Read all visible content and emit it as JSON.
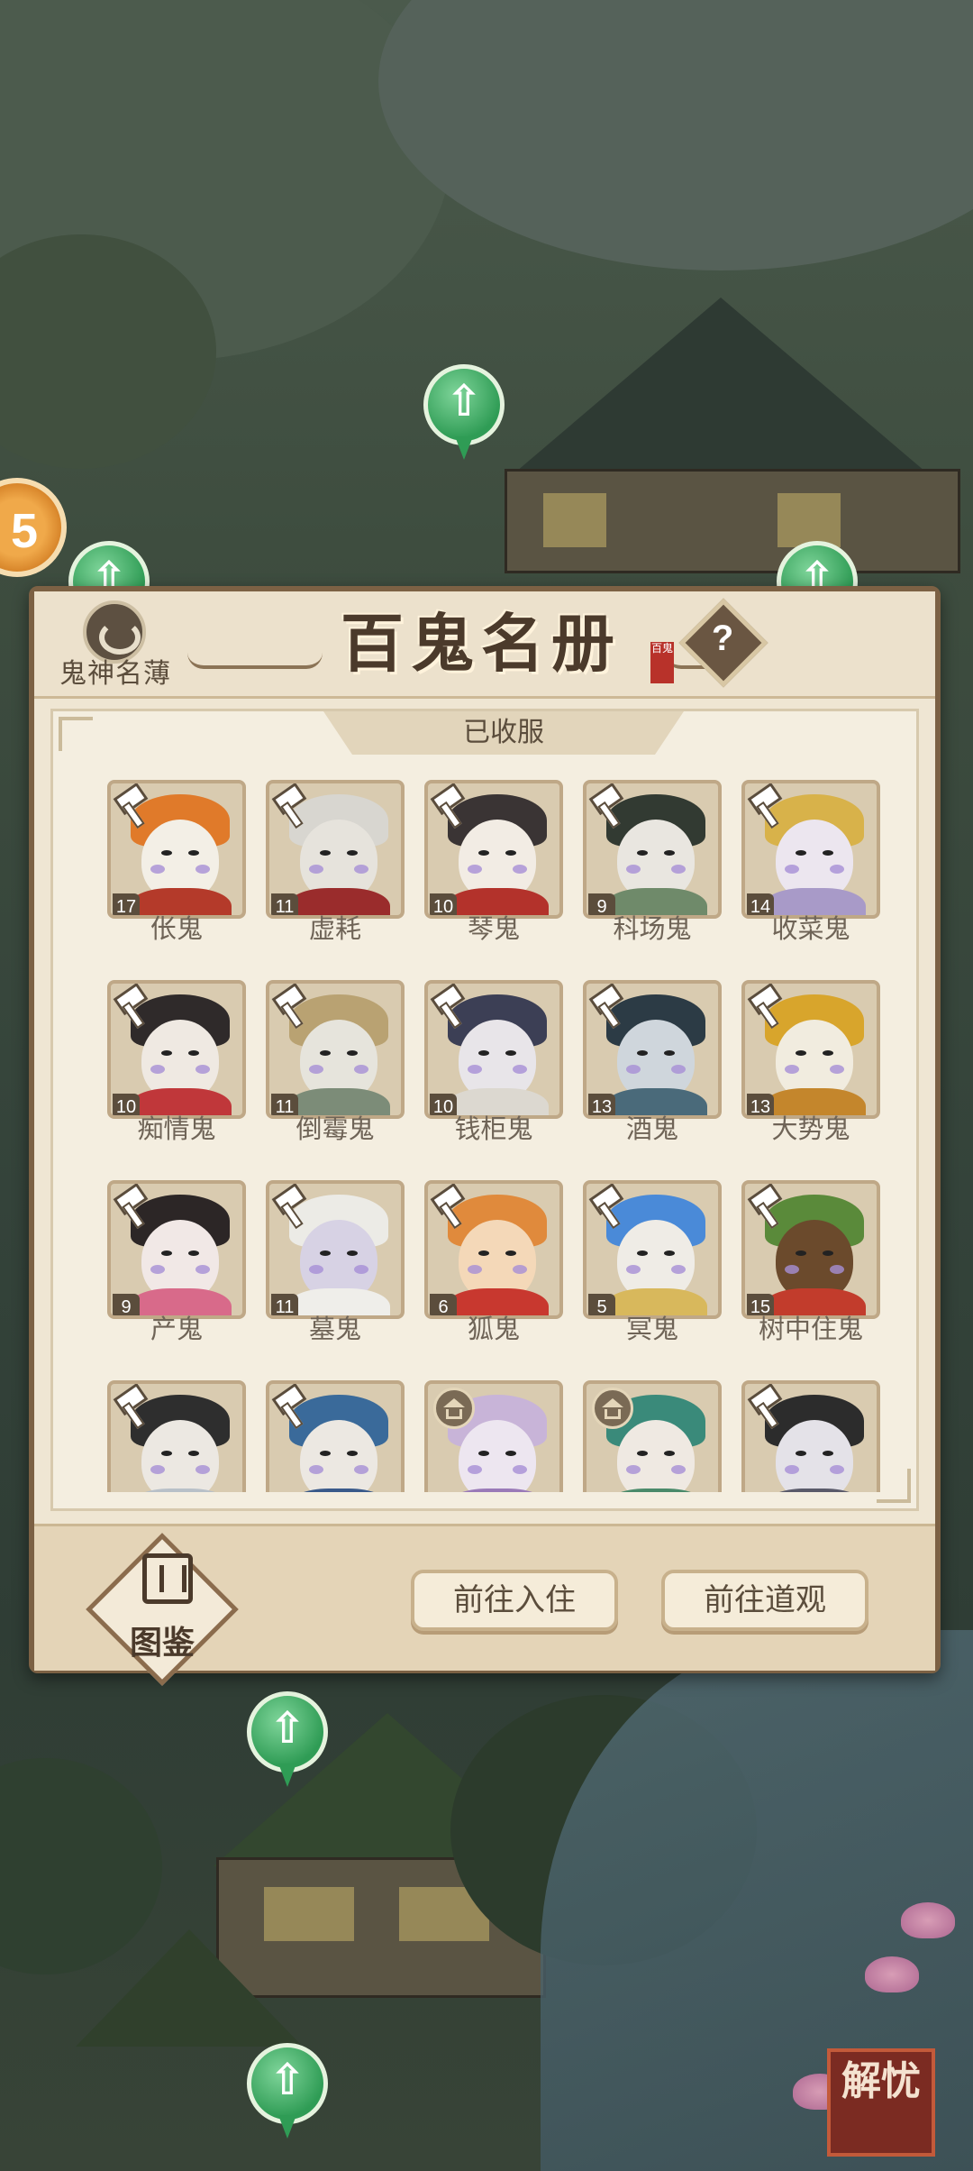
{
  "panel": {
    "codex_label": "鬼神名薄",
    "title": "百鬼名册",
    "stamp": "百鬼",
    "help_icon": "?",
    "tab": "已收服"
  },
  "ghosts": [
    {
      "name": "伥鬼",
      "level": "17",
      "marker": "hammer",
      "hair": "#e07a2a",
      "skin": "#f3efe6",
      "body": "#b43a2a"
    },
    {
      "name": "虚耗",
      "level": "11",
      "marker": "hammer",
      "hair": "#d8d6d0",
      "skin": "#e6e3dc",
      "body": "#9a2c2c"
    },
    {
      "name": "琴鬼",
      "level": "10",
      "marker": "hammer",
      "hair": "#3a3434",
      "skin": "#f2ece4",
      "body": "#b3322b"
    },
    {
      "name": "科场鬼",
      "level": "9",
      "marker": "hammer",
      "hair": "#323a32",
      "skin": "#e9e6e0",
      "body": "#6f8a6a"
    },
    {
      "name": "收菜鬼",
      "level": "14",
      "marker": "hammer",
      "hair": "#d8b24a",
      "skin": "#ece6ef",
      "body": "#a89ac8"
    },
    {
      "name": "痴情鬼",
      "level": "10",
      "marker": "hammer",
      "hair": "#2f2a2a",
      "skin": "#efe9e2",
      "body": "#c0373a"
    },
    {
      "name": "倒霉鬼",
      "level": "11",
      "marker": "hammer",
      "hair": "#b9a272",
      "skin": "#e6e4dc",
      "body": "#7c8c78"
    },
    {
      "name": "钱柜鬼",
      "level": "10",
      "marker": "hammer",
      "hair": "#3c3f55",
      "skin": "#e8e5e9",
      "body": "#dcd8d0"
    },
    {
      "name": "酒鬼",
      "level": "13",
      "marker": "hammer",
      "hair": "#2c3b45",
      "skin": "#cfd6dc",
      "body": "#4a6a7a"
    },
    {
      "name": "大势鬼",
      "level": "13",
      "marker": "hammer",
      "hair": "#d8a52c",
      "skin": "#f1ecdf",
      "body": "#c4862c"
    },
    {
      "name": "产鬼",
      "level": "9",
      "marker": "hammer",
      "hair": "#2c2626",
      "skin": "#f1e8e6",
      "body": "#d86a8a"
    },
    {
      "name": "墓鬼",
      "level": "11",
      "marker": "hammer",
      "hair": "#ecebe6",
      "skin": "#d7d2e4",
      "body": "#efeeea"
    },
    {
      "name": "狐鬼",
      "level": "6",
      "marker": "hammer",
      "hair": "#e08a3c",
      "skin": "#f4d8b8",
      "body": "#c8382f"
    },
    {
      "name": "冥鬼",
      "level": "5",
      "marker": "hammer",
      "hair": "#4a8ad8",
      "skin": "#efece6",
      "body": "#d8b85c"
    },
    {
      "name": "树中住鬼",
      "level": "15",
      "marker": "hammer",
      "hair": "#5a8a3a",
      "skin": "#6b4a2c",
      "body": "#c23c2c"
    },
    {
      "name": "",
      "level": "",
      "marker": "hammer",
      "hair": "#2e2e2e",
      "skin": "#ece8e2",
      "body": "#b8c0c8"
    },
    {
      "name": "",
      "level": "",
      "marker": "hammer",
      "hair": "#3a6a9a",
      "skin": "#ece8e2",
      "body": "#3a5a8a"
    },
    {
      "name": "",
      "level": "",
      "marker": "temple",
      "hair": "#c8b4d8",
      "skin": "#ede6f0",
      "body": "#9a7ab8"
    },
    {
      "name": "",
      "level": "",
      "marker": "temple",
      "hair": "#3a8a7a",
      "skin": "#efe9e2",
      "body": "#4a8a6a"
    },
    {
      "name": "",
      "level": "",
      "marker": "hammer",
      "hair": "#2c2c2c",
      "skin": "#e4e2e8",
      "body": "#5a5a6a"
    }
  ],
  "footer": {
    "atlas_label": "图鉴",
    "btn_checkin": "前往入住",
    "btn_temple": "前往道观"
  },
  "scene": {
    "seal_text": "解忧",
    "side_token_glyph": "5"
  }
}
